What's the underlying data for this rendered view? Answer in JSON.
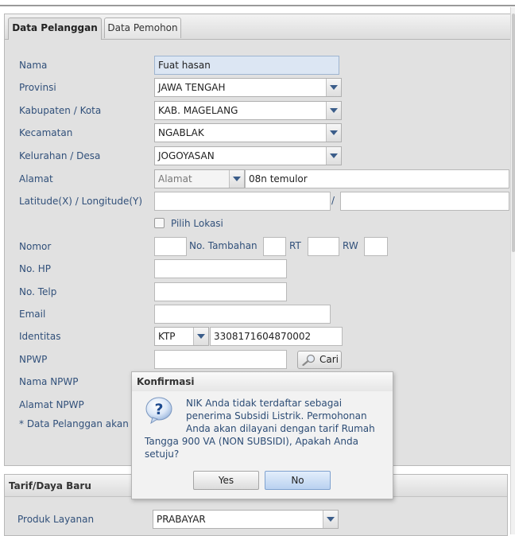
{
  "tabs": {
    "active": "Data Pelanggan",
    "inactive": "Data Pemohon"
  },
  "form": {
    "nama_label": "Nama",
    "nama_value": "Fuat hasan",
    "provinsi_label": "Provinsi",
    "provinsi_value": "JAWA TENGAH",
    "kabupaten_label": "Kabupaten / Kota",
    "kabupaten_value": "KAB. MAGELANG",
    "kecamatan_label": "Kecamatan",
    "kecamatan_value": "NGABLAK",
    "kelurahan_label": "Kelurahan / Desa",
    "kelurahan_value": "JOGOYASAN",
    "alamat_label": "Alamat",
    "alamat_type": "Alamat",
    "alamat_value": "08n temulor",
    "latlong_label": "Latitude(X) / Longitude(Y)",
    "latlong_sep": "/",
    "pilih_lokasi": "Pilih Lokasi",
    "nomor_label": "Nomor",
    "no_tambahan_label": "No. Tambahan",
    "rt_label": "RT",
    "rw_label": "RW",
    "nohp_label": "No. HP",
    "notelp_label": "No. Telp",
    "email_label": "Email",
    "identitas_label": "Identitas",
    "identitas_type": "KTP",
    "identitas_value": "3308171604870002",
    "npwp_label": "NPWP",
    "cari_label": "Cari",
    "nama_npwp_label": "Nama NPWP",
    "alamat_npwp_label": "Alamat NPWP",
    "note": "* Data Pelanggan akan dip"
  },
  "tarif": {
    "title": "Tarif/Daya Baru",
    "produk_label": "Produk Layanan",
    "produk_value": "PRABAYAR"
  },
  "dialog": {
    "title": "Konfirmasi",
    "message_line1": "NIK Anda tidak terdaftar sebagai",
    "message_line2": "penerima Subsidi Listrik. Permohonan",
    "message_line3": "Anda akan dilayani dengan tarif Rumah",
    "message_line4": "Tangga 900 VA (NON SUBSIDI), Apakah Anda",
    "message_line5": "setuju?",
    "yes_label": "Yes",
    "no_label": "No"
  },
  "colors": {
    "label": "#31507a",
    "panel_bg": "#e1e1e1",
    "focus_btn": "#b9d1f0"
  }
}
